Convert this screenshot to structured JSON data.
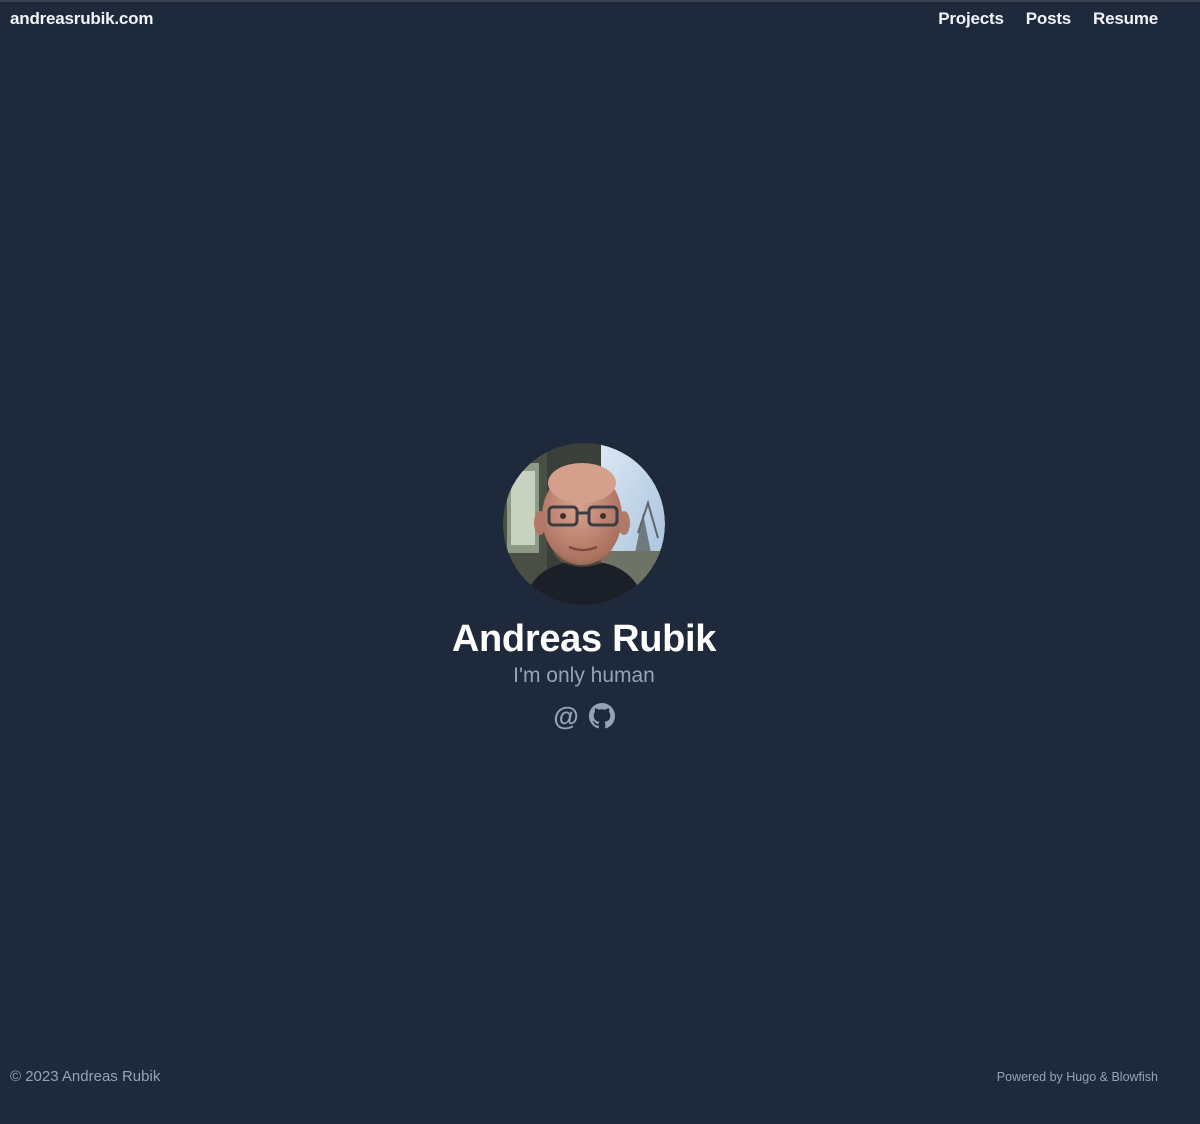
{
  "header": {
    "site_title": "andreasrubik.com",
    "nav": [
      {
        "label": "Projects"
      },
      {
        "label": "Posts"
      },
      {
        "label": "Resume"
      }
    ]
  },
  "profile": {
    "avatar_icon": "profile-photo",
    "name": "Andreas Rubik",
    "tagline": "I'm only human",
    "links": [
      {
        "icon": "email-icon",
        "glyph": "@"
      },
      {
        "icon": "github-icon"
      }
    ]
  },
  "footer": {
    "copyright": "© 2023 Andreas Rubik",
    "powered_prefix": "Powered by ",
    "hugo": "Hugo",
    "amp": " & ",
    "blowfish": "Blowfish"
  },
  "colors": {
    "background": "#1e293b",
    "text": "#f1f5f9",
    "muted": "#94a3b8"
  }
}
